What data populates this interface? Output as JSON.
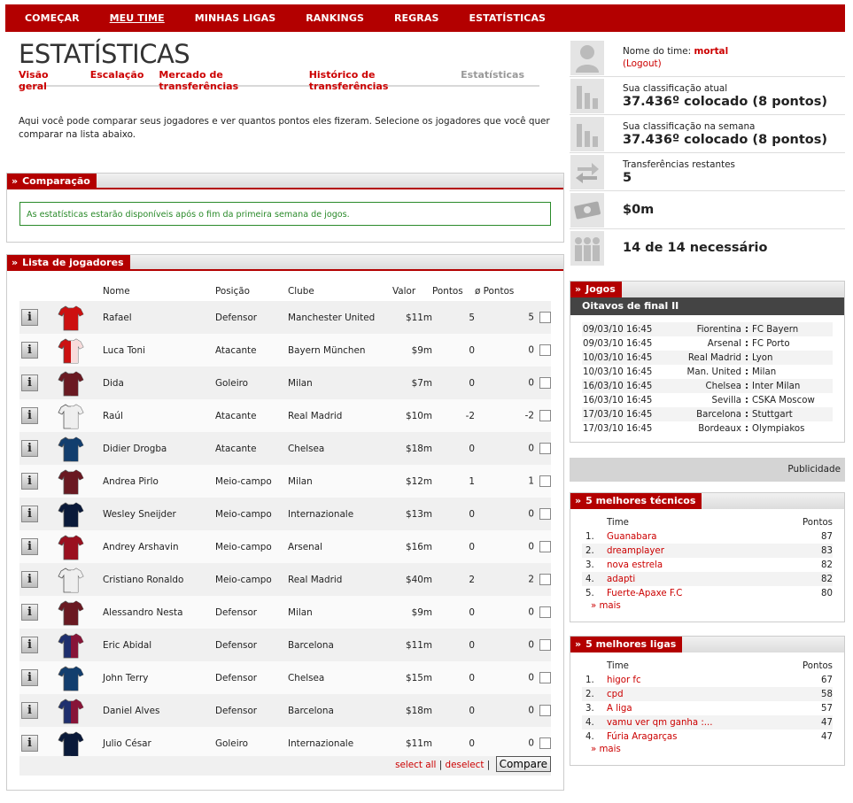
{
  "nav": {
    "items": [
      "COMEÇAR",
      "MEU TIME",
      "MINHAS LIGAS",
      "RANKINGS",
      "REGRAS",
      "ESTATÍSTICAS"
    ]
  },
  "page": {
    "title": "ESTATÍSTICAS",
    "subnav": [
      "Visão geral",
      "Escalação",
      "Mercado de transferências",
      "Histórico de transferências",
      "Estatísticas"
    ],
    "intro": "Aqui você pode comparar seus jogadores e ver quantos pontos eles fizeram. Selecione os jogadores que você quer comparar na lista abaixo."
  },
  "comparacao": {
    "title": "Comparação",
    "message": "As estatísticas estarão disponíveis após o fim da primeira semana de jogos."
  },
  "lista": {
    "title": "Lista de jogadores",
    "headers": {
      "nome": "Nome",
      "posicao": "Posição",
      "clube": "Clube",
      "valor": "Valor",
      "pontos": "Pontos",
      "avg": "ø Pontos"
    },
    "info_label": "i",
    "players": [
      {
        "name": "Rafael",
        "pos": "Defensor",
        "club": "Manchester United",
        "value": "$11m",
        "points": "5",
        "avg": "5",
        "shirt": "#cc1111",
        "shirt2": "#cc1111"
      },
      {
        "name": "Luca Toni",
        "pos": "Atacante",
        "club": "Bayern München",
        "value": "$9m",
        "points": "0",
        "avg": "0",
        "shirt": "#cc1111",
        "shirt2": "#ffffff"
      },
      {
        "name": "Dida",
        "pos": "Goleiro",
        "club": "Milan",
        "value": "$7m",
        "points": "0",
        "avg": "0",
        "shirt": "#6a1a22",
        "shirt2": "#6a1a22"
      },
      {
        "name": "Raúl",
        "pos": "Atacante",
        "club": "Real Madrid",
        "value": "$10m",
        "points": "-2",
        "avg": "-2",
        "shirt": "#eeeeee",
        "shirt2": "#eeeeee"
      },
      {
        "name": "Didier Drogba",
        "pos": "Atacante",
        "club": "Chelsea",
        "value": "$18m",
        "points": "0",
        "avg": "0",
        "shirt": "#133e6e",
        "shirt2": "#133e6e"
      },
      {
        "name": "Andrea Pirlo",
        "pos": "Meio-campo",
        "club": "Milan",
        "value": "$12m",
        "points": "1",
        "avg": "1",
        "shirt": "#6a1a22",
        "shirt2": "#6a1a22"
      },
      {
        "name": "Wesley Sneijder",
        "pos": "Meio-campo",
        "club": "Internazionale",
        "value": "$13m",
        "points": "0",
        "avg": "0",
        "shirt": "#0a1a3a",
        "shirt2": "#0a1a3a"
      },
      {
        "name": "Andrey Arshavin",
        "pos": "Meio-campo",
        "club": "Arsenal",
        "value": "$16m",
        "points": "0",
        "avg": "0",
        "shirt": "#9a1020",
        "shirt2": "#9a1020"
      },
      {
        "name": "Cristiano Ronaldo",
        "pos": "Meio-campo",
        "club": "Real Madrid",
        "value": "$40m",
        "points": "2",
        "avg": "2",
        "shirt": "#eeeeee",
        "shirt2": "#eeeeee"
      },
      {
        "name": "Alessandro Nesta",
        "pos": "Defensor",
        "club": "Milan",
        "value": "$9m",
        "points": "0",
        "avg": "0",
        "shirt": "#6a1a22",
        "shirt2": "#6a1a22"
      },
      {
        "name": "Eric Abidal",
        "pos": "Defensor",
        "club": "Barcelona",
        "value": "$11m",
        "points": "0",
        "avg": "0",
        "shirt": "#1e2f6e",
        "shirt2": "#9a1030"
      },
      {
        "name": "John Terry",
        "pos": "Defensor",
        "club": "Chelsea",
        "value": "$15m",
        "points": "0",
        "avg": "0",
        "shirt": "#133e6e",
        "shirt2": "#133e6e"
      },
      {
        "name": "Daniel Alves",
        "pos": "Defensor",
        "club": "Barcelona",
        "value": "$18m",
        "points": "0",
        "avg": "0",
        "shirt": "#1e2f6e",
        "shirt2": "#9a1030"
      },
      {
        "name": "Julio César",
        "pos": "Goleiro",
        "club": "Internazionale",
        "value": "$11m",
        "points": "0",
        "avg": "0",
        "shirt": "#0a1a3a",
        "shirt2": "#0a1a3a"
      }
    ],
    "select_all": "select all",
    "separator": "|",
    "deselect": "deselect",
    "compare": "Compare"
  },
  "sidebar": {
    "team_label": "Nome do time:",
    "team_name": "mortal",
    "logout": "(Logout)",
    "rank_label": "Sua classificação atual",
    "rank_value": "37.436º colocado (8 pontos)",
    "week_label": "Sua classificação na semana",
    "week_value": "37.436º colocado (8 pontos)",
    "transfers_label": "Transferências restantes",
    "transfers_value": "5",
    "money_value": "$0m",
    "required_value": "14 de 14 necessário"
  },
  "jogos": {
    "title": "Jogos",
    "subtitle": "Oitavos de final II",
    "matches": [
      {
        "date": "09/03/10 16:45",
        "home": "Fiorentina",
        "sep": ":",
        "away": "FC Bayern"
      },
      {
        "date": "09/03/10 16:45",
        "home": "Arsenal",
        "sep": ":",
        "away": "FC Porto"
      },
      {
        "date": "10/03/10 16:45",
        "home": "Real Madrid",
        "sep": ":",
        "away": "Lyon"
      },
      {
        "date": "10/03/10 16:45",
        "home": "Man. United",
        "sep": ":",
        "away": "Milan"
      },
      {
        "date": "16/03/10 16:45",
        "home": "Chelsea",
        "sep": ":",
        "away": "Inter Milan"
      },
      {
        "date": "16/03/10 16:45",
        "home": "Sevilla",
        "sep": ":",
        "away": "CSKA Moscow"
      },
      {
        "date": "17/03/10 16:45",
        "home": "Barcelona",
        "sep": ":",
        "away": "Stuttgart"
      },
      {
        "date": "17/03/10 16:45",
        "home": "Bordeaux",
        "sep": ":",
        "away": "Olympiakos"
      }
    ]
  },
  "publicidade": "Publicidade",
  "tecnicos": {
    "title": "5 melhores técnicos",
    "col_time": "Time",
    "col_pontos": "Pontos",
    "rows": [
      {
        "rank": "1.",
        "name": "Guanabara",
        "points": "87"
      },
      {
        "rank": "2.",
        "name": "dreamplayer",
        "points": "83"
      },
      {
        "rank": "3.",
        "name": "nova estrela",
        "points": "82"
      },
      {
        "rank": "4.",
        "name": "adapti",
        "points": "82"
      },
      {
        "rank": "5.",
        "name": "Fuerte-Apaxe F.C",
        "points": "80"
      }
    ],
    "mais": "» mais"
  },
  "ligas": {
    "title": "5 melhores ligas",
    "col_time": "Time",
    "col_pontos": "Pontos",
    "rows": [
      {
        "rank": "1.",
        "name": "higor fc",
        "points": "67"
      },
      {
        "rank": "2.",
        "name": "cpd",
        "points": "58"
      },
      {
        "rank": "3.",
        "name": "A liga",
        "points": "57"
      },
      {
        "rank": "4.",
        "name": "vamu ver qm ganha :...",
        "points": "47"
      },
      {
        "rank": "4.",
        "name": "Fúria Aragarças",
        "points": "47"
      }
    ],
    "mais": "» mais"
  },
  "colors": {
    "brand": "#b30000",
    "link": "#cc0000",
    "success": "#2a8a2a"
  }
}
